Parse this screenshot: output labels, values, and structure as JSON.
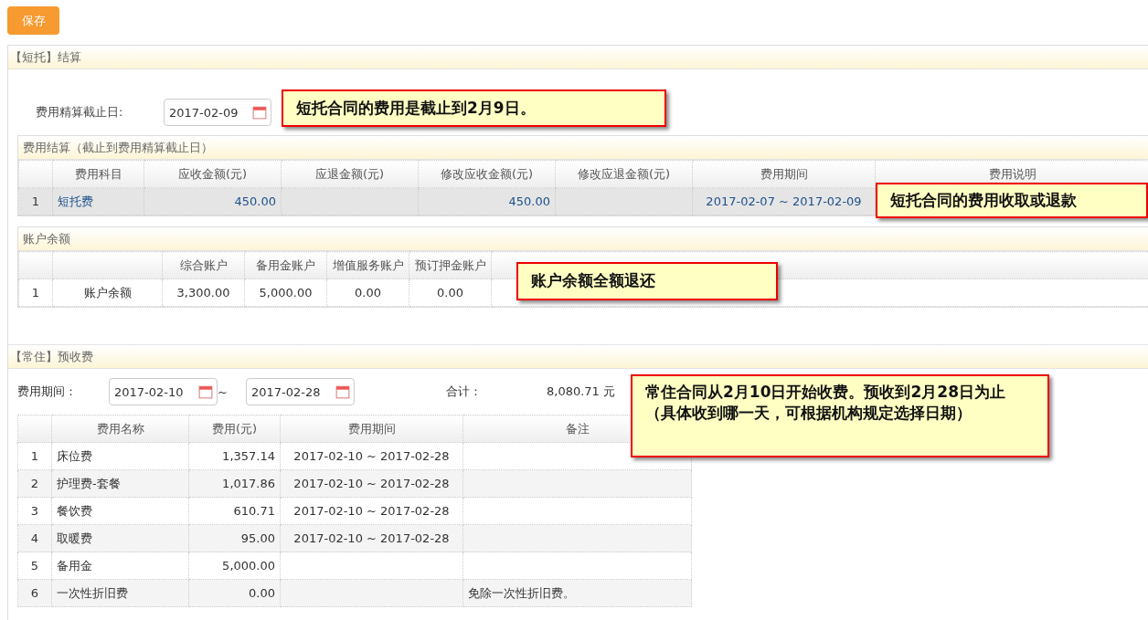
{
  "save_button": "保存",
  "short_term": {
    "title": "【短托】结算",
    "cutoff_label": "费用精算截止日:",
    "cutoff_value": "2017-02-09",
    "fees": {
      "title": "费用结算（截止到费用精算截止日）",
      "columns": [
        null,
        "费用科目",
        "应收金额(元)",
        "应退金额(元)",
        "修改应收金额(元)",
        "修改应退金额(元)",
        "费用期间",
        "费用说明"
      ],
      "rows": [
        {
          "selected": true,
          "cells": [
            "1",
            "短托费",
            "450.00",
            null,
            "450.00",
            null,
            "2017-02-07 ~ 2017-02-09",
            null
          ]
        }
      ]
    },
    "balance": {
      "title": "账户余额",
      "columns": [
        null,
        null,
        "综合账户",
        "备用金账户",
        "增值服务账户",
        "预订押金账户"
      ],
      "rows": [
        {
          "selected": false,
          "cells": [
            "1",
            "账户余额",
            "3,300.00",
            "5,000.00",
            "0.00",
            "0.00"
          ]
        }
      ]
    }
  },
  "long_term": {
    "title": "【常住】预收费",
    "period_label": "费用期间：",
    "from": "2017-02-10",
    "separator": "~",
    "to": "2017-02-28",
    "total_label": "合计：",
    "total": "8,080.71 元",
    "columns": [
      null,
      "费用名称",
      "费用(元)",
      "费用期间",
      "备注"
    ],
    "rows": [
      {
        "cells": [
          "1",
          "床位费",
          "1,357.14",
          "2017-02-10 ~ 2017-02-28",
          null
        ]
      },
      {
        "cells": [
          "2",
          "护理费-套餐",
          "1,017.86",
          "2017-02-10 ~ 2017-02-28",
          null
        ]
      },
      {
        "cells": [
          "3",
          "餐饮费",
          "610.71",
          "2017-02-10 ~ 2017-02-28",
          null
        ]
      },
      {
        "cells": [
          "4",
          "取暖费",
          "95.00",
          "2017-02-10 ~ 2017-02-28",
          null
        ]
      },
      {
        "cells": [
          "5",
          "备用金",
          "5,000.00",
          null,
          null
        ]
      },
      {
        "cells": [
          "6",
          "一次性折旧费",
          "0.00",
          null,
          "免除一次性折旧费。"
        ]
      }
    ]
  },
  "callouts": [
    {
      "text": "短托合同的费用是截止到2月9日。"
    },
    {
      "text": "短托合同的费用收取或退款"
    },
    {
      "text": "账户余额全额退还"
    },
    {
      "text": "常住合同从2月10日开始收费。预收到2月28日为止（具体收到哪一天，可根据机构规定选择日期）"
    }
  ]
}
